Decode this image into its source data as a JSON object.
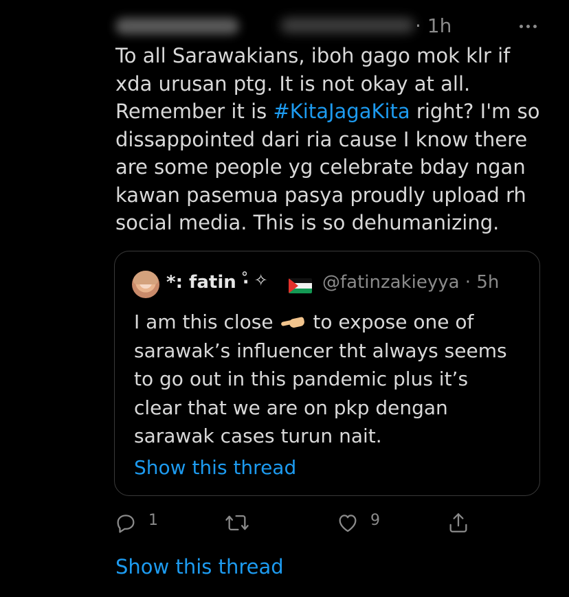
{
  "tweet": {
    "time": "· 1h",
    "text_before": "To all Sarawakians, iboh gago mok klr if\nxda urusan ptg. It is not okay at all.\nRemember it is ",
    "hashtag": "#KitaJagaKita",
    "text_after": " right? I'm so\ndissappointed dari ria cause I know there\nare some people yg celebrate bday ngan\nkawan pasemua pasya proudly upload rh\nsocial media. This is so dehumanizing."
  },
  "quote": {
    "name": "*: fatin ·",
    "decor": "˚ ✧",
    "handle": "@fatinzakieyya · 5h",
    "text_before": "I am this close ",
    "text_after": " to expose one of\nsarawak’s influencer tht always seems\nto go out in this pandemic plus it’s\nclear that we are on pkp dengan\nsarawak cases turun nait.",
    "show_thread": "Show this thread"
  },
  "actions": {
    "reply_count": "1",
    "retweet_count": "",
    "like_count": "9"
  },
  "show_thread": "Show this thread",
  "colors": {
    "background": "#000000",
    "text": "#d9d9d9",
    "muted": "#8b8b8b",
    "link": "#1d9bf0",
    "border": "#3a3a3a"
  },
  "icons": {
    "more": "more-horizontal-icon",
    "reply": "reply-icon",
    "retweet": "retweet-icon",
    "like": "heart-icon",
    "share": "share-icon",
    "flag": "palestine-flag-icon",
    "emoji": "pinching-hand-emoji"
  }
}
